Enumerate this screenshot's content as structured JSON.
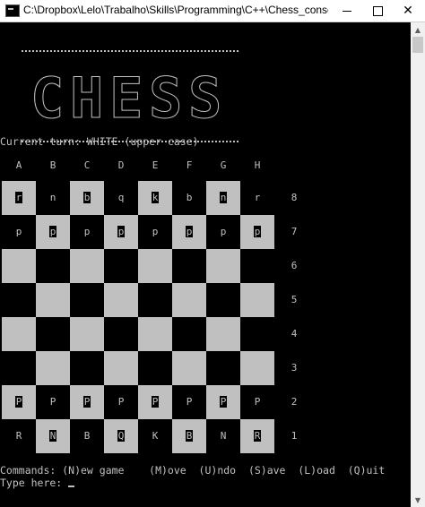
{
  "window": {
    "title": "C:\\Dropbox\\Lelo\\Trabalho\\Skills\\Programming\\C++\\Chess_console\\code\\Che..."
  },
  "banner": {
    "letters": [
      "C",
      "H",
      "E",
      "S",
      "S"
    ]
  },
  "status": {
    "current_turn": "Current turn: WHITE (upper case)"
  },
  "board": {
    "columns": [
      "A",
      "B",
      "C",
      "D",
      "E",
      "F",
      "G",
      "H"
    ],
    "rows": [
      "8",
      "7",
      "6",
      "5",
      "4",
      "3",
      "2",
      "1"
    ],
    "pieces": [
      [
        "r",
        "n",
        "b",
        "q",
        "k",
        "b",
        "n",
        "r"
      ],
      [
        "p",
        "p",
        "p",
        "p",
        "p",
        "p",
        "p",
        "p"
      ],
      [
        "",
        "",
        "",
        "",
        "",
        "",
        "",
        ""
      ],
      [
        "",
        "",
        "",
        "",
        "",
        "",
        "",
        ""
      ],
      [
        "",
        "",
        "",
        "",
        "",
        "",
        "",
        ""
      ],
      [
        "",
        "",
        "",
        "",
        "",
        "",
        "",
        ""
      ],
      [
        "P",
        "P",
        "P",
        "P",
        "P",
        "P",
        "P",
        "P"
      ],
      [
        "R",
        "N",
        "B",
        "Q",
        "K",
        "B",
        "N",
        "R"
      ]
    ],
    "light_color": "#c0c0c0",
    "dark_color": "#000000"
  },
  "commands": {
    "text": "Commands: (N)ew game    (M)ove  (U)ndo  (S)ave  (L)oad  (Q)uit"
  },
  "prompt": {
    "text": "Type here: "
  }
}
